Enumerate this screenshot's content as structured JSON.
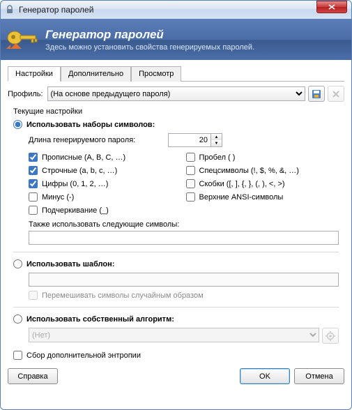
{
  "window": {
    "title": "Генератор паролей"
  },
  "banner": {
    "title": "Генератор паролей",
    "subtitle": "Здесь можно установить свойства генерируемых паролей."
  },
  "tabs": {
    "settings": "Настройки",
    "advanced": "Дополнительно",
    "preview": "Просмотр"
  },
  "profile": {
    "label": "Профиль:",
    "selected": "(На основе предыдущего пароля)"
  },
  "group": {
    "current": "Текущие настройки"
  },
  "radios": {
    "charset": "Использовать наборы символов:",
    "pattern": "Использовать шаблон:",
    "algorithm": "Использовать собственный алгоритм:"
  },
  "length": {
    "label": "Длина генерируемого пароля:",
    "value": "20"
  },
  "checks": {
    "upper": {
      "label": "Прописные (A, B, C, …)",
      "checked": true
    },
    "lower": {
      "label": "Строчные (a, b, c, …)",
      "checked": true
    },
    "digits": {
      "label": "Цифры (0, 1, 2, …)",
      "checked": true
    },
    "minus": {
      "label": "Минус (-)",
      "checked": false
    },
    "under": {
      "label": "Подчеркивание (_)",
      "checked": false
    },
    "space": {
      "label": "Пробел ( )",
      "checked": false
    },
    "special": {
      "label": "Спецсимволы (!, $, %, &, …)",
      "checked": false
    },
    "brackets": {
      "label": "Скобки ([, ], {, }, (, ), <, >)",
      "checked": false
    },
    "ansi": {
      "label": "Верхние ANSI-символы",
      "checked": false
    }
  },
  "also": {
    "label": "Также использовать следующие символы:",
    "value": ""
  },
  "pattern": {
    "value": "",
    "permute": "Перемешивать символы случайным образом"
  },
  "algorithm": {
    "selected": "(Нет)"
  },
  "entropy": {
    "label": "Сбор дополнительной энтропии"
  },
  "buttons": {
    "help": "Справка",
    "ok": "OK",
    "cancel": "Отмена"
  },
  "icons": {
    "lock": "lock-icon",
    "key": "key-icon",
    "close": "close-icon",
    "save": "save-profile-icon",
    "delete": "delete-profile-icon",
    "gear": "gear-icon",
    "up": "spin-up-icon",
    "down": "spin-down-icon"
  },
  "colors": {
    "accent": "#3b78c4",
    "bannerTop": "#5a7db8",
    "bannerBottom": "#3a5a8f"
  }
}
